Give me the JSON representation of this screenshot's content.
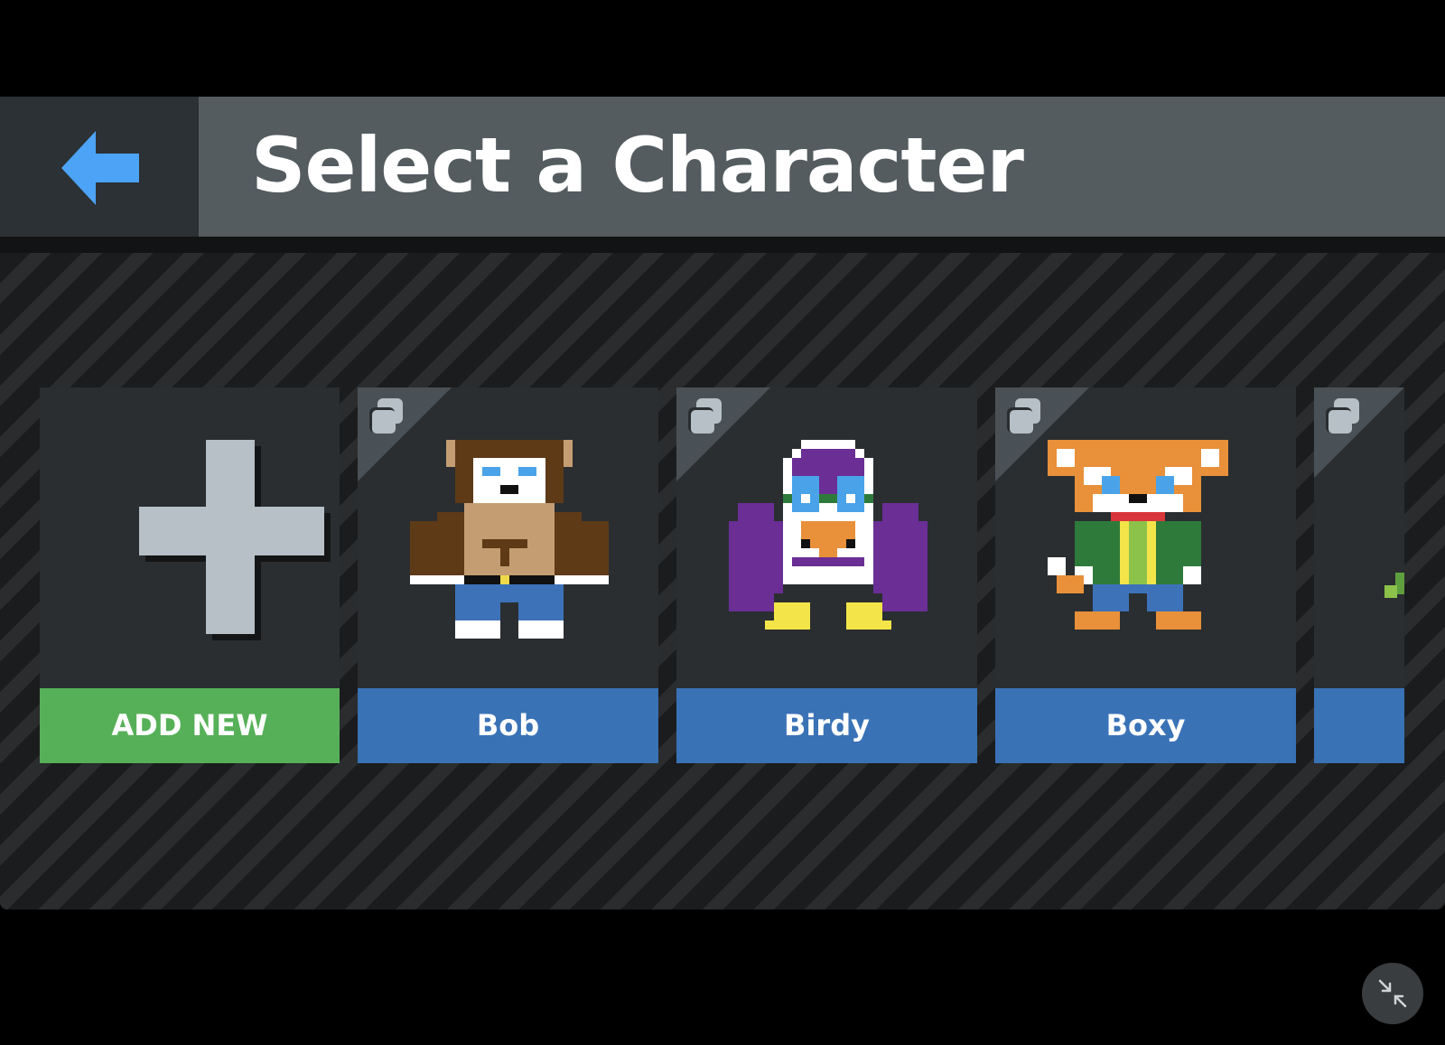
{
  "header": {
    "title": "Select a Character",
    "back_icon": "arrow-left-icon",
    "back_icon_color": "#4da3f5"
  },
  "characters": [
    {
      "label": "ADD NEW",
      "type": "add",
      "icon": "plus-icon",
      "color": "#56b058"
    },
    {
      "label": "Bob",
      "type": "character",
      "sprite": "bear",
      "color": "#3a72b6"
    },
    {
      "label": "Birdy",
      "type": "character",
      "sprite": "bird",
      "color": "#3a72b6"
    },
    {
      "label": "Boxy",
      "type": "character",
      "sprite": "fox",
      "color": "#3a72b6"
    },
    {
      "label": "",
      "type": "character",
      "sprite": "partial",
      "color": "#3a72b6"
    }
  ],
  "duplicate_icon": "duplicate-icon",
  "footer": {
    "minimize_icon": "minimize-icon"
  }
}
